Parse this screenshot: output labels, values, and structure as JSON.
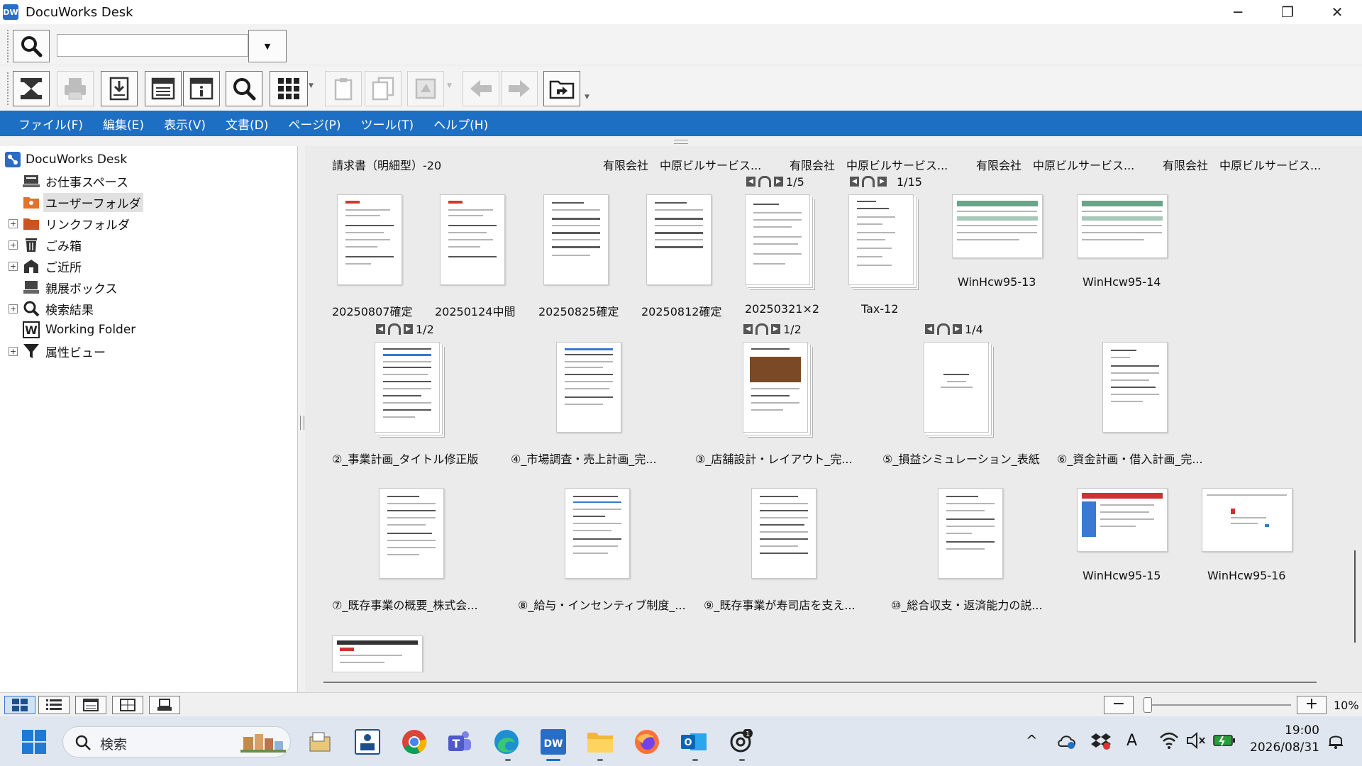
{
  "window": {
    "title": "DocuWorks Desk",
    "minimize_glyph": "─",
    "maximize_glyph": "❐",
    "close_glyph": "✕"
  },
  "search": {
    "value": "",
    "placeholder": ""
  },
  "toolbar_icons": [
    "binder-icon",
    "print-icon",
    "import-icon",
    "viewer-icon",
    "properties-icon",
    "search-icon",
    "thumbnail-view-icon",
    "paste-icon",
    "copy-icon",
    "convert-icon",
    "back-icon",
    "forward-icon",
    "folder-move-icon"
  ],
  "menu": {
    "items": [
      "ファイル(F)",
      "編集(E)",
      "表示(V)",
      "文書(D)",
      "ページ(P)",
      "ツール(T)",
      "ヘルプ(H)"
    ]
  },
  "tree": {
    "root": "DocuWorks Desk",
    "items": [
      {
        "label": "お仕事スペース",
        "icon": "workspace-icon",
        "expandable": false
      },
      {
        "label": "ユーザーフォルダ",
        "icon": "user-folder-icon",
        "expandable": false,
        "selected": true
      },
      {
        "label": "リンクフォルダ",
        "icon": "link-folder-icon",
        "expandable": true
      },
      {
        "label": "ごみ箱",
        "icon": "trash-icon",
        "expandable": true
      },
      {
        "label": "ご近所",
        "icon": "neighborhood-icon",
        "expandable": true
      },
      {
        "label": "親展ボックス",
        "icon": "confidential-box-icon",
        "expandable": false
      },
      {
        "label": "検索結果",
        "icon": "search-result-icon",
        "expandable": true
      },
      {
        "label": "Working Folder",
        "icon": "working-folder-icon",
        "expandable": false
      },
      {
        "label": "属性ビュー",
        "icon": "filter-icon",
        "expandable": true
      }
    ],
    "expand_glyph": "+"
  },
  "content": {
    "top_captions": [
      "請求書（明細型）-20",
      "有限会社　中原ビルサービス...",
      "有限会社　中原ビルサービス...",
      "有限会社　中原ビルサービス...",
      "有限会社　中原ビルサービス..."
    ],
    "docs": [
      {
        "name": "20250807確定"
      },
      {
        "name": "20250124中間"
      },
      {
        "name": "20250825確定"
      },
      {
        "name": "20250812確定"
      },
      {
        "name": "20250321×2",
        "pages": "1/5"
      },
      {
        "name": "Tax-12",
        "pages": "1/15"
      },
      {
        "name": "WinHcw95-13"
      },
      {
        "name": "WinHcw95-14"
      },
      {
        "name": "②_事業計画_タイトル修正版",
        "pages": "1/2"
      },
      {
        "name": "④_市場調査・売上計画_完..."
      },
      {
        "name": "③_店舗設計・レイアウト_完...",
        "pages": "1/2"
      },
      {
        "name": "⑤_損益シミュレーション_表紙",
        "pages": "1/4"
      },
      {
        "name": "⑥_資金計画・借入計画_完..."
      },
      {
        "name": "⑦_既存事業の概要_株式会..."
      },
      {
        "name": "⑧_給与・インセンティブ制度_..."
      },
      {
        "name": "⑨_既存事業が寿司店を支え..."
      },
      {
        "name": "⑩_総合収支・返済能力の説..."
      },
      {
        "name": "WinHcw95-15"
      },
      {
        "name": "WinHcw95-16"
      }
    ],
    "pager_prev": "◀",
    "pager_next": "▶"
  },
  "statusbar": {
    "view_icons": [
      "thumbnail-large-icon",
      "list-icon",
      "detail-icon",
      "tile-icon",
      "tray-icon"
    ],
    "zoom_minus": "−",
    "zoom_plus": "+",
    "zoom": "10%",
    "zoom_level": 0.02
  },
  "taskbar": {
    "search_label": "検索",
    "time": "19:00",
    "date": "2026/08/31",
    "chatgpt_badge": "1",
    "tray_chevron": "^",
    "ime": "A",
    "apps": [
      "start-icon",
      "task-search",
      "file-explorer-alt-icon",
      "docuworks-viewer-icon",
      "chrome-icon",
      "teams-icon",
      "edge-icon",
      "docuworks-desk-icon",
      "file-explorer-icon",
      "firefox-icon",
      "outlook-icon",
      "chatgpt-icon"
    ]
  },
  "colors": {
    "menubar": "#1d6fc4",
    "accent": "#3a78d1"
  }
}
